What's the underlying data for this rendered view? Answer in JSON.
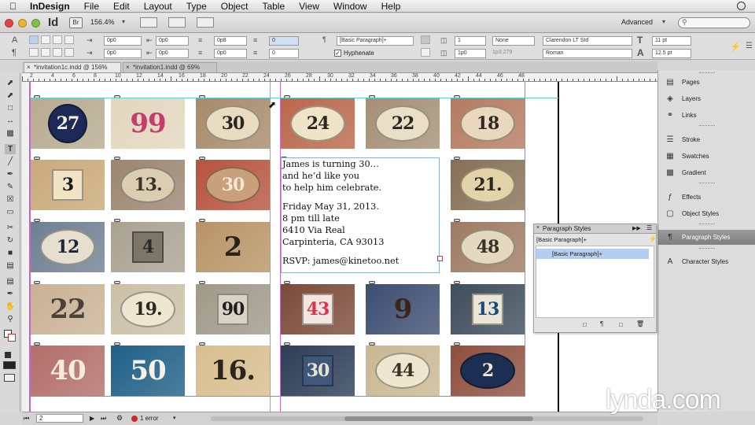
{
  "menubar": {
    "items": [
      "InDesign",
      "File",
      "Edit",
      "Layout",
      "Type",
      "Object",
      "Table",
      "View",
      "Window",
      "Help"
    ],
    "clock_icon": "clock-icon"
  },
  "appbar": {
    "app_badge": "Id",
    "bridge_badge": "Br",
    "zoom": "156.4%",
    "workspace": "Advanced",
    "search_placeholder": ""
  },
  "control_panel": {
    "indent_left": "0p0",
    "indent_right": "0p0",
    "indent_first": "0p0",
    "indent_last": "0p0",
    "space_before": "0p8",
    "space_after": "0p0",
    "space_before2": "0",
    "drop_lines": "0",
    "paragraph_style": "[Basic Paragraph]+",
    "hyphenate_label": "Hyphenate",
    "columns": "1",
    "gutter": "1p0",
    "gutter_readout": "1p3.279",
    "align_grid": "None",
    "font_family": "Clarendon LT Std",
    "font_style": "Roman",
    "font_size": "11 pt",
    "leading": "12.5 pt"
  },
  "tabs": [
    {
      "label": "*invitation1c.indd @ 156%",
      "active": true
    },
    {
      "label": "*invitation1.indd @ 69%",
      "active": false
    }
  ],
  "ruler": {
    "labels": [
      "2",
      "4",
      "6",
      "8",
      "10",
      "12",
      "14",
      "16",
      "18",
      "20",
      "22",
      "24",
      "26",
      "28",
      "30",
      "32",
      "34",
      "36",
      "38",
      "40",
      "42",
      "44",
      "46",
      "48"
    ]
  },
  "tiles": [
    {
      "num": "27",
      "fg": "#f5f0e0",
      "bg": "#b7aa8f",
      "shape": "circle",
      "shape_bg": "#1d2a57"
    },
    {
      "num": "99",
      "fg": "#c73b6d",
      "bg": "#e2d6bd",
      "shape": "none",
      "shape_bg": ""
    },
    {
      "num": "30",
      "fg": "#2a2620",
      "bg": "#a78a6a",
      "shape": "oval",
      "shape_bg": "#e8dcc0"
    },
    {
      "num": "24",
      "fg": "#2a2620",
      "bg": "#b9674a",
      "shape": "oval",
      "shape_bg": "#efe3c8"
    },
    {
      "num": "22",
      "fg": "#2a2620",
      "bg": "#a58f74",
      "shape": "oval",
      "shape_bg": "#e9dec6"
    },
    {
      "num": "18",
      "fg": "#2f2a22",
      "bg": "#b47b5f",
      "shape": "oval",
      "shape_bg": "#e9d8bd"
    },
    {
      "num": "3",
      "fg": "#1a1a1a",
      "bg": "#c9a979",
      "shape": "square",
      "shape_bg": "#f1e4c6"
    },
    {
      "num": "13.",
      "fg": "#3a3328",
      "bg": "#9b8570",
      "shape": "oval",
      "shape_bg": "#dacdb2"
    },
    {
      "num": "30",
      "fg": "#f2e8d4",
      "bg": "#b6533f",
      "shape": "oval",
      "shape_bg": "#c8a07b"
    },
    {
      "num": "21.",
      "fg": "#2c2820",
      "bg": "#857055",
      "shape": "oval",
      "shape_bg": "#e3d3a9"
    },
    {
      "num": "12",
      "fg": "#1e2638",
      "bg": "#6f7f92",
      "shape": "oval",
      "shape_bg": "#e6dfd0"
    },
    {
      "num": "4",
      "fg": "#2a2a2a",
      "bg": "#a9a292",
      "shape": "square",
      "shape_bg": "#7d7566"
    },
    {
      "num": "2",
      "fg": "#2b2219",
      "bg": "#b89466",
      "shape": "none",
      "shape_bg": ""
    },
    {
      "num": "48",
      "fg": "#3a332a",
      "bg": "#9e7b62",
      "shape": "oval",
      "shape_bg": "#e4d8bf"
    },
    {
      "num": "22",
      "fg": "#4a4238",
      "bg": "#c9b294",
      "shape": "none",
      "shape_bg": ""
    },
    {
      "num": "19.",
      "fg": "#2c2820",
      "bg": "#cbbfa6",
      "shape": "oval",
      "shape_bg": "#efe6d2"
    },
    {
      "num": "90",
      "fg": "#1f1f1f",
      "bg": "#9f9989",
      "shape": "square",
      "shape_bg": "#d9d3c4"
    },
    {
      "num": "43",
      "fg": "#d9344f",
      "bg": "#7b4a39",
      "shape": "square",
      "shape_bg": "#f1e7de"
    },
    {
      "num": "9",
      "fg": "#3a2517",
      "bg": "#3d4e72",
      "shape": "none",
      "shape_bg": ""
    },
    {
      "num": "13",
      "fg": "#1a4a7a",
      "bg": "#3e4d5c",
      "shape": "square",
      "shape_bg": "#eae5d6"
    },
    {
      "num": "40",
      "fg": "#f4ecda",
      "bg": "#b26e6a",
      "shape": "none",
      "shape_bg": ""
    },
    {
      "num": "50",
      "fg": "#f6f1e3",
      "bg": "#1f5f87",
      "shape": "none",
      "shape_bg": ""
    },
    {
      "num": "16.",
      "fg": "#2b2520",
      "bg": "#d8bd8e",
      "shape": "none",
      "shape_bg": ""
    },
    {
      "num": "30",
      "fg": "#e8e2d3",
      "bg": "#2c3d56",
      "shape": "square",
      "shape_bg": "#3f5779"
    },
    {
      "num": "44",
      "fg": "#3b3125",
      "bg": "#c9b791",
      "shape": "oval",
      "shape_bg": "#efe6cf"
    },
    {
      "num": "2",
      "fg": "#f1e6d0",
      "bg": "#8f4f3e",
      "shape": "oval",
      "shape_bg": "#1c2f52"
    }
  ],
  "invitation": {
    "lines": [
      "James is turning 30…",
      "and he’d like you",
      "to help him celebrate.",
      "",
      "Friday May 31, 2013.",
      "8 pm till late",
      "6410 Via Real",
      "Carpinteria, CA 93013",
      "",
      "RSVP: james@kinetoo.net"
    ]
  },
  "status": {
    "page": "2",
    "preflight": "1 error"
  },
  "dock": {
    "items": [
      {
        "label": "Pages",
        "icon": "pages-icon",
        "active": false
      },
      {
        "label": "Layers",
        "icon": "layers-icon",
        "active": false
      },
      {
        "label": "Links",
        "icon": "links-icon",
        "active": false
      },
      {
        "label": "Stroke",
        "icon": "stroke-icon",
        "active": false
      },
      {
        "label": "Swatches",
        "icon": "swatches-icon",
        "active": false
      },
      {
        "label": "Gradient",
        "icon": "gradient-icon",
        "active": false
      },
      {
        "label": "Effects",
        "icon": "effects-icon",
        "active": false
      },
      {
        "label": "Object Styles",
        "icon": "object-styles-icon",
        "active": false
      },
      {
        "label": "Paragraph Styles",
        "icon": "paragraph-styles-icon",
        "active": true
      },
      {
        "label": "Character Styles",
        "icon": "character-styles-icon",
        "active": false
      }
    ]
  },
  "para_panel": {
    "title": "Paragraph Styles",
    "current": "[Basic Paragraph]+",
    "selected_item": "[Basic Paragraph]+"
  },
  "watermark": "lynda.com",
  "colors": {
    "accent": "#5b8fd6",
    "guide": "#c86cc8",
    "selection": "#b5cdf0"
  }
}
